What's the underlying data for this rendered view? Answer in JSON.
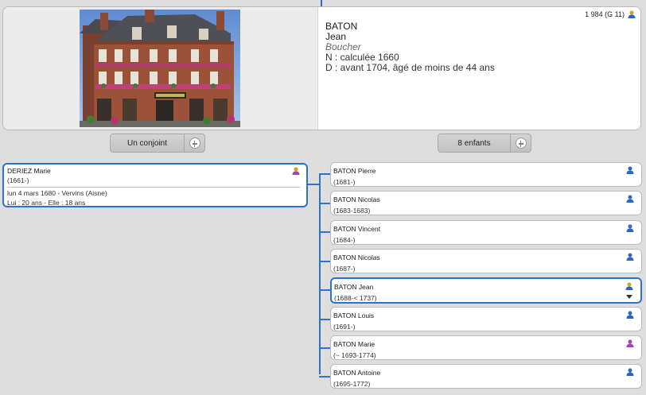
{
  "person": {
    "sosa": "1 984 (G 11)",
    "lastname": "BATON",
    "firstname": "Jean",
    "occupation": "Boucher",
    "birth": "N : calculée 1660",
    "death": "D : avant 1704,  âgé de moins de 44 ans",
    "icon": "person-gold-icon"
  },
  "buttons": {
    "spouse_label": "Un conjoint",
    "children_label": "8 enfants"
  },
  "spouse": {
    "name": "DERIEZ Marie",
    "years": "(1661-)",
    "marriage": "lun 4 mars 1680 - Vervins (Aisne)",
    "ages": "Lui : 20 ans - Elle : 18 ans",
    "icon": "person-purple-icon"
  },
  "children": [
    {
      "name": "BATON Pierre",
      "years": "(1681-)",
      "gender": "male"
    },
    {
      "name": "BATON Nicolas",
      "years": "(1683-1683)",
      "gender": "male"
    },
    {
      "name": "BATON Vincent",
      "years": "(1684-)",
      "gender": "male"
    },
    {
      "name": "BATON Nicolas",
      "years": "(1687-)",
      "gender": "male"
    },
    {
      "name": "BATON Jean",
      "years": "(1688-< 1737)",
      "gender": "male",
      "selected": true
    },
    {
      "name": "BATON Louis",
      "years": "(1691-)",
      "gender": "male"
    },
    {
      "name": "BATON Marie",
      "years": "(~ 1693-1774)",
      "gender": "female"
    },
    {
      "name": "BATON Antoine",
      "years": "(1695-1772)",
      "gender": "male"
    }
  ],
  "colors": {
    "accent": "#2f73c9",
    "male": "#2f67bf",
    "female": "#a243b8",
    "self_head": "#d4a017",
    "self_body": "#2f67bf"
  }
}
